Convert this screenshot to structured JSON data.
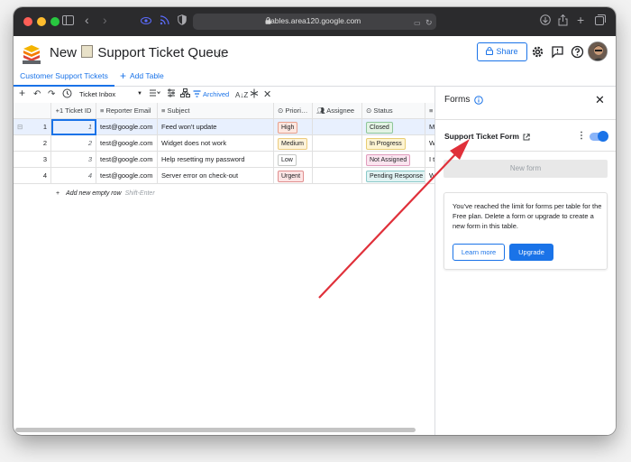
{
  "browser": {
    "url": "tables.area120.google.com"
  },
  "header": {
    "title_pre": "New",
    "title_post": "Support Ticket Queue",
    "share_label": "Share"
  },
  "tables": {
    "active_tab": "Customer Support Tickets",
    "add_table_label": "Add Table"
  },
  "toolbar": {
    "view": "Ticket Inbox",
    "archived_label": "Archived"
  },
  "grid": {
    "columns": [
      "Ticket ID",
      "Reporter Email",
      "Subject",
      "Priori…",
      "Assignee",
      "Status"
    ],
    "rows": [
      {
        "num": "1",
        "id": "1",
        "email": "test@google.com",
        "subject": "Feed won't update",
        "priority": "High",
        "status": "Closed",
        "extra": "My"
      },
      {
        "num": "2",
        "id": "2",
        "email": "test@google.com",
        "subject": "Widget does not work",
        "priority": "Medium",
        "status": "In Progress",
        "extra": "Wh"
      },
      {
        "num": "3",
        "id": "3",
        "email": "test@google.com",
        "subject": "Help resetting my password",
        "priority": "Low",
        "status": "Not Assigned",
        "extra": "I ta"
      },
      {
        "num": "4",
        "id": "4",
        "email": "test@google.com",
        "subject": "Server error on check-out",
        "priority": "Urgent",
        "status": "Pending Response",
        "extra": "Wh"
      }
    ],
    "add_row_label": "Add new empty row",
    "add_row_hint": "Shift-Enter"
  },
  "chip_colors": {
    "High": {
      "bg": "#fde7e0",
      "border": "#e8a08c"
    },
    "Medium": {
      "bg": "#fdf3da",
      "border": "#eccb7d"
    },
    "Low": {
      "bg": "#ffffff",
      "border": "#c4c7c5"
    },
    "Urgent": {
      "bg": "#fce4e4",
      "border": "#e08d8d"
    },
    "Closed": {
      "bg": "#e3f3e4",
      "border": "#8ec69a"
    },
    "In Progress": {
      "bg": "#fdf4d3",
      "border": "#e8cd72"
    },
    "Not Assigned": {
      "bg": "#fbe4ef",
      "border": "#e09cbd"
    },
    "Pending Response": {
      "bg": "#e1f3f3",
      "border": "#89c9c9"
    }
  },
  "panel": {
    "title": "Forms",
    "form_name": "Support Ticket Form",
    "new_form_label": "New form",
    "limit_message": "You've reached the limit for forms per table for the Free plan. Delete a form or upgrade to create a new form in this table.",
    "learn_more_label": "Learn more",
    "upgrade_label": "Upgrade"
  },
  "annotation": {
    "arrow_color": "#e0303a"
  }
}
